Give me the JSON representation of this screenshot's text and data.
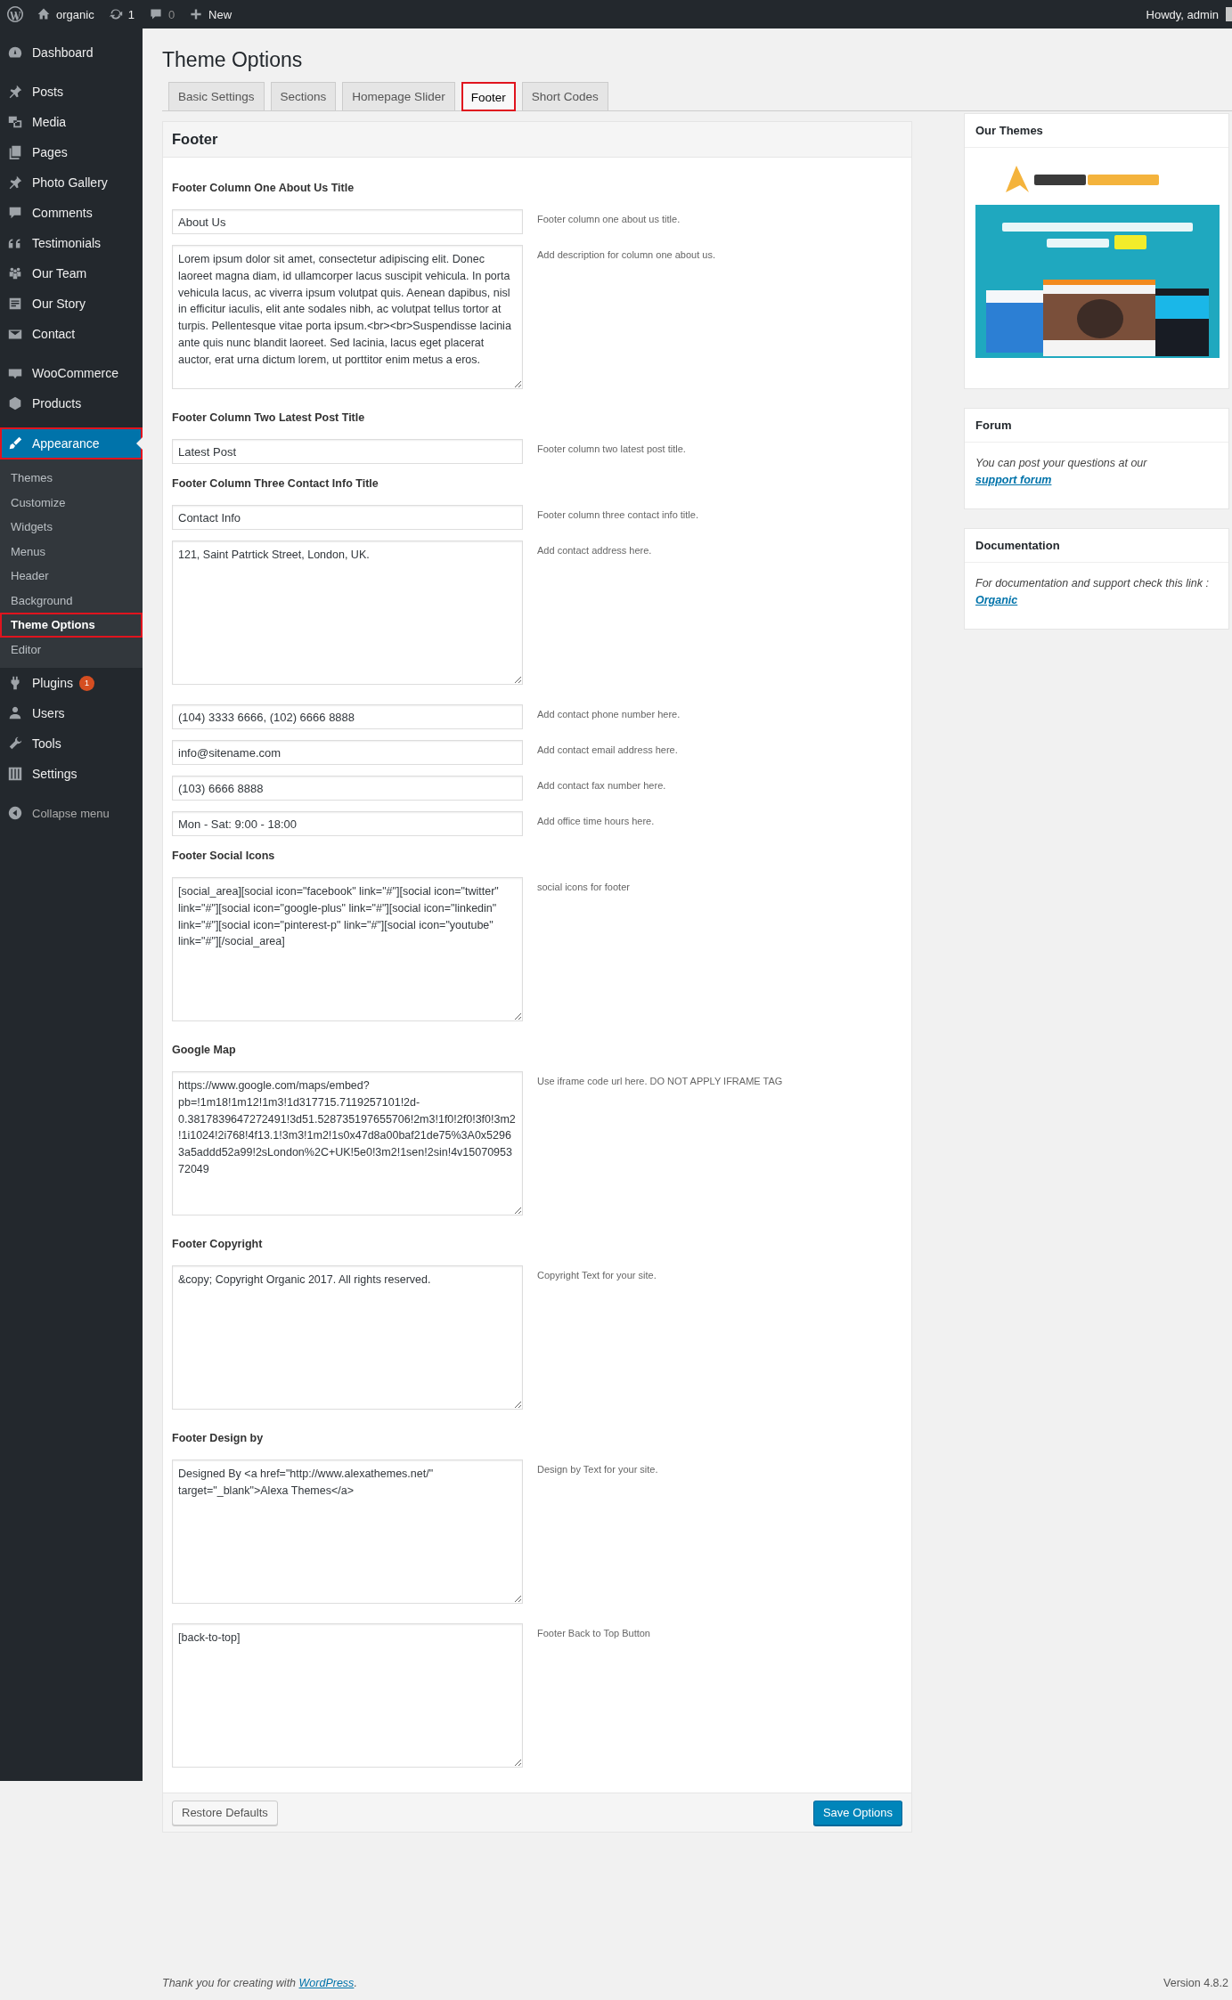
{
  "admin_bar": {
    "site": "organic",
    "updates": "1",
    "comments": "0",
    "new": "New",
    "greeting": "Howdy, admin"
  },
  "sidebar": {
    "groups": [
      [
        {
          "label": "Dashboard",
          "selected": false,
          "highlighted": false
        }
      ],
      [
        {
          "label": "Posts",
          "selected": false,
          "highlighted": false
        },
        {
          "label": "Media",
          "selected": false,
          "highlighted": false
        },
        {
          "label": "Pages",
          "selected": false,
          "highlighted": false
        },
        {
          "label": "Photo Gallery",
          "selected": false,
          "highlighted": false
        },
        {
          "label": "Comments",
          "selected": false,
          "highlighted": false
        },
        {
          "label": "Testimonials",
          "selected": false,
          "highlighted": false
        },
        {
          "label": "Our Team",
          "selected": false,
          "highlighted": false
        },
        {
          "label": "Our Story",
          "selected": false,
          "highlighted": false
        },
        {
          "label": "Contact",
          "selected": false,
          "highlighted": false
        }
      ],
      [
        {
          "label": "WooCommerce",
          "selected": false,
          "highlighted": false
        },
        {
          "label": "Products",
          "selected": false,
          "highlighted": false
        }
      ],
      [
        {
          "label": "Appearance",
          "selected": true,
          "highlighted": true,
          "children": [
            {
              "label": "Themes",
              "selected": false,
              "highlighted": false
            },
            {
              "label": "Customize",
              "selected": false,
              "highlighted": false
            },
            {
              "label": "Widgets",
              "selected": false,
              "highlighted": false
            },
            {
              "label": "Menus",
              "selected": false,
              "highlighted": false
            },
            {
              "label": "Header",
              "selected": false,
              "highlighted": false
            },
            {
              "label": "Background",
              "selected": false,
              "highlighted": false
            },
            {
              "label": "Theme Options",
              "selected": true,
              "highlighted": true
            },
            {
              "label": "Editor",
              "selected": false,
              "highlighted": false
            }
          ]
        },
        {
          "label": "Plugins",
          "selected": false,
          "highlighted": false,
          "badge": "1"
        },
        {
          "label": "Users",
          "selected": false,
          "highlighted": false
        },
        {
          "label": "Tools",
          "selected": false,
          "highlighted": false
        },
        {
          "label": "Settings",
          "selected": false,
          "highlighted": false
        }
      ]
    ],
    "collapse": "Collapse menu"
  },
  "title": "Theme Options",
  "tabs": [
    {
      "label": "Basic Settings",
      "selected": false,
      "highlighted": false
    },
    {
      "label": "Sections",
      "selected": false,
      "highlighted": false
    },
    {
      "label": "Homepage Slider",
      "selected": false,
      "highlighted": false
    },
    {
      "label": "Footer",
      "selected": true,
      "highlighted": true
    },
    {
      "label": "Short Codes",
      "selected": false,
      "highlighted": false
    }
  ],
  "panel": {
    "heading": "Footer",
    "sections": [
      {
        "label": "Footer Column One About Us Title",
        "controls": [
          {
            "kind": "input",
            "value": "About Us",
            "description": "Footer column one about us title."
          },
          {
            "kind": "textarea",
            "value": "Lorem ipsum dolor sit amet, consectetur adipiscing elit. Donec laoreet magna diam, id ullamcorper lacus suscipit vehicula. In porta vehicula lacus, ac viverra ipsum volutpat quis. Aenean dapibus, nisl in efficitur iaculis, elit ante sodales nibh, ac volutpat tellus tortor at turpis. Pellentesque vitae porta ipsum.<br><br>Suspendisse lacinia ante quis nunc blandit laoreet. Sed lacinia, lacus eget placerat auctor, erat urna dictum lorem, ut porttitor enim metus a eros.",
            "description": "Add description for column one about us."
          }
        ]
      },
      {
        "label": "Footer Column Two Latest Post Title",
        "controls": [
          {
            "kind": "input",
            "value": "Latest Post",
            "description": "Footer column two latest post title."
          }
        ]
      },
      {
        "label": "Footer Column Three Contact Info Title",
        "controls": [
          {
            "kind": "input",
            "value": "Contact Info",
            "description": "Footer column three contact info title."
          },
          {
            "kind": "textarea",
            "value": "121, Saint Patrtick Street, London, UK.",
            "description": "Add contact address here."
          },
          {
            "kind": "input",
            "value": "(104) 3333 6666, (102) 6666 8888",
            "description": "Add contact phone number here."
          },
          {
            "kind": "input",
            "value": "info@sitename.com",
            "description": "Add contact email address here."
          },
          {
            "kind": "input",
            "value": "(103) 6666 8888",
            "description": "Add contact fax number here."
          },
          {
            "kind": "input",
            "value": "Mon - Sat: 9:00 - 18:00",
            "description": "Add office time hours here."
          }
        ]
      },
      {
        "label": "Footer Social Icons",
        "controls": [
          {
            "kind": "textarea",
            "value": "[social_area][social icon=\"facebook\" link=\"#\"][social icon=\"twitter\" link=\"#\"][social icon=\"google-plus\" link=\"#\"][social icon=\"linkedin\" link=\"#\"][social icon=\"pinterest-p\" link=\"#\"][social icon=\"youtube\" link=\"#\"][/social_area]",
            "description": "social icons for footer"
          }
        ]
      },
      {
        "label": "Google Map",
        "controls": [
          {
            "kind": "textarea",
            "value": "https://www.google.com/maps/embed?pb=!1m18!1m12!1m3!1d317715.7119257101!2d-0.3817839647272491!3d51.528735197655706!2m3!1f0!2f0!3f0!3m2!1i1024!2i768!4f13.1!3m3!1m2!1s0x47d8a00baf21de75%3A0x52963a5addd52a99!2sLondon%2C+UK!5e0!3m2!1sen!2sin!4v1507095372049",
            "description": "Use iframe code url here. DO NOT APPLY IFRAME TAG"
          }
        ]
      },
      {
        "label": "Footer Copyright",
        "controls": [
          {
            "kind": "textarea",
            "value": "&copy; Copyright Organic 2017. All rights reserved.",
            "description": "Copyright Text for your site."
          }
        ]
      },
      {
        "label": "Footer Design by",
        "controls": [
          {
            "kind": "textarea",
            "value": "Designed By <a href=\"http://www.alexathemes.net/\" target=\"_blank\">Alexa Themes</a>",
            "description": "Design by Text for your site."
          },
          {
            "kind": "textarea",
            "value": "[back-to-top]",
            "description": "Footer Back to Top Button"
          }
        ]
      }
    ],
    "restore_button": "Restore Defaults",
    "save_button": "Save Options"
  },
  "widgets": [
    {
      "title": "Our Themes",
      "kind": "picture"
    },
    {
      "title": "Forum",
      "kind": "text",
      "text": "You can post your questions at our ",
      "link": "support forum"
    },
    {
      "title": "Documentation",
      "kind": "text",
      "text": "For documentation and support check this link : ",
      "link": "Organic"
    }
  ],
  "footer": {
    "thanks": "Thank you for creating with ",
    "link": "WordPress",
    "after": ".",
    "version": "Version 4.8.2"
  }
}
